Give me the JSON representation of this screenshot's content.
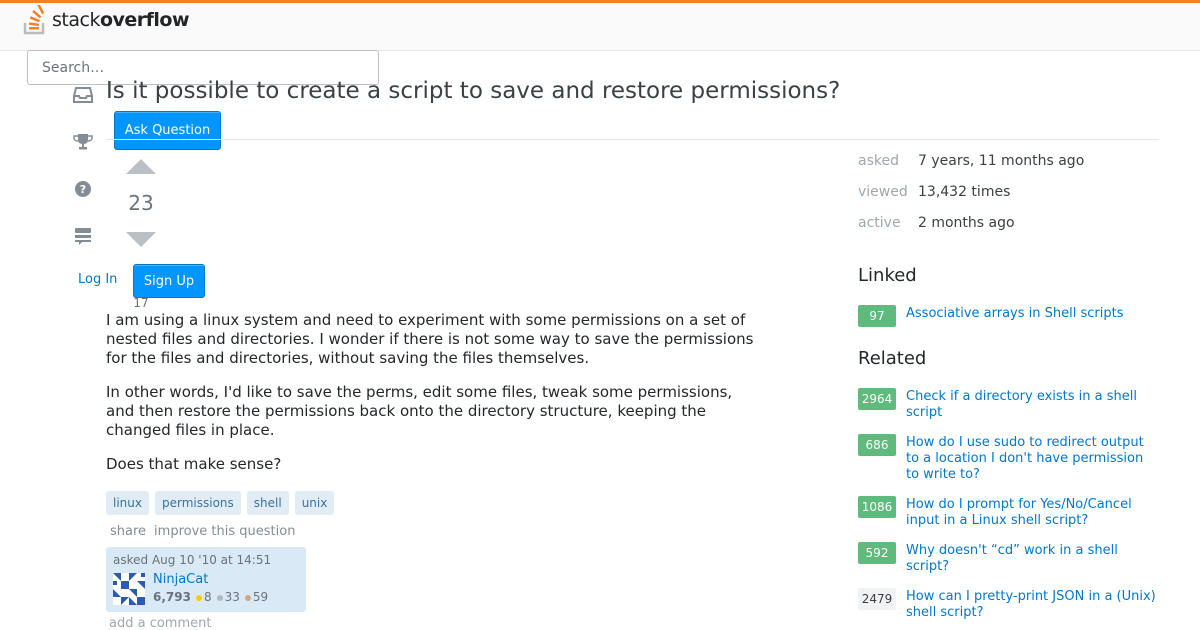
{
  "header": {
    "logo_text_light": "stack",
    "logo_text_bold": "overflow",
    "search_placeholder": "Search…"
  },
  "nav": {
    "ask_question": "Ask Question",
    "log_in": "Log In",
    "sign_up": "Sign Up"
  },
  "question": {
    "title": "Is it possible to create a script to save and restore permissions?",
    "votes": "23",
    "favorites": "17",
    "body": [
      "I am using a linux system and need to experiment with some permissions on a set of nested files and directories. I wonder if there is not some way to save the permissions for the files and directories, without saving the files themselves.",
      "In other words, I'd like to save the perms, edit some files, tweak some permissions, and then restore the permissions back onto the directory structure, keeping the changed files in place.",
      "Does that make sense?"
    ],
    "tags": [
      "linux",
      "permissions",
      "shell",
      "unix"
    ],
    "menu": {
      "share": "share",
      "improve": "improve this question"
    },
    "owner": {
      "asked": "asked Aug 10 '10 at 14:51",
      "name": "NinjaCat",
      "reputation": "6,793",
      "gold": "8",
      "silver": "33",
      "bronze": "59"
    },
    "add_comment": "add a comment"
  },
  "meta": [
    {
      "label": "asked",
      "value": "7 years, 11 months ago"
    },
    {
      "label": "viewed",
      "value": "13,432 times"
    },
    {
      "label": "active",
      "value": "2 months ago"
    }
  ],
  "linked": {
    "heading": "Linked",
    "items": [
      {
        "score": "97",
        "title": "Associative arrays in Shell scripts"
      }
    ]
  },
  "related": {
    "heading": "Related",
    "items": [
      {
        "score": "2964",
        "title": "Check if a directory exists in a shell script"
      },
      {
        "score": "686",
        "title": "How do I use sudo to redirect output to a location I don't have permission to write to?"
      },
      {
        "score": "1086",
        "title": "How do I prompt for Yes/No/Cancel input in a Linux shell script?"
      },
      {
        "score": "592",
        "title": "Why doesn't “cd” work in a shell script?"
      },
      {
        "score": "2479",
        "title": "How can I pretty-print JSON in a (Unix) shell script?"
      }
    ]
  },
  "colors": {
    "accent_orange": "#f48024",
    "button_blue": "#0095ff",
    "link_blue": "#0077cc",
    "tag_bg": "#e1ecf4",
    "score_green": "#5eba7d"
  },
  "icons": [
    "inbox-icon",
    "trophy-icon",
    "help-icon",
    "review-queue-icon",
    "upvote-icon",
    "downvote-icon"
  ]
}
